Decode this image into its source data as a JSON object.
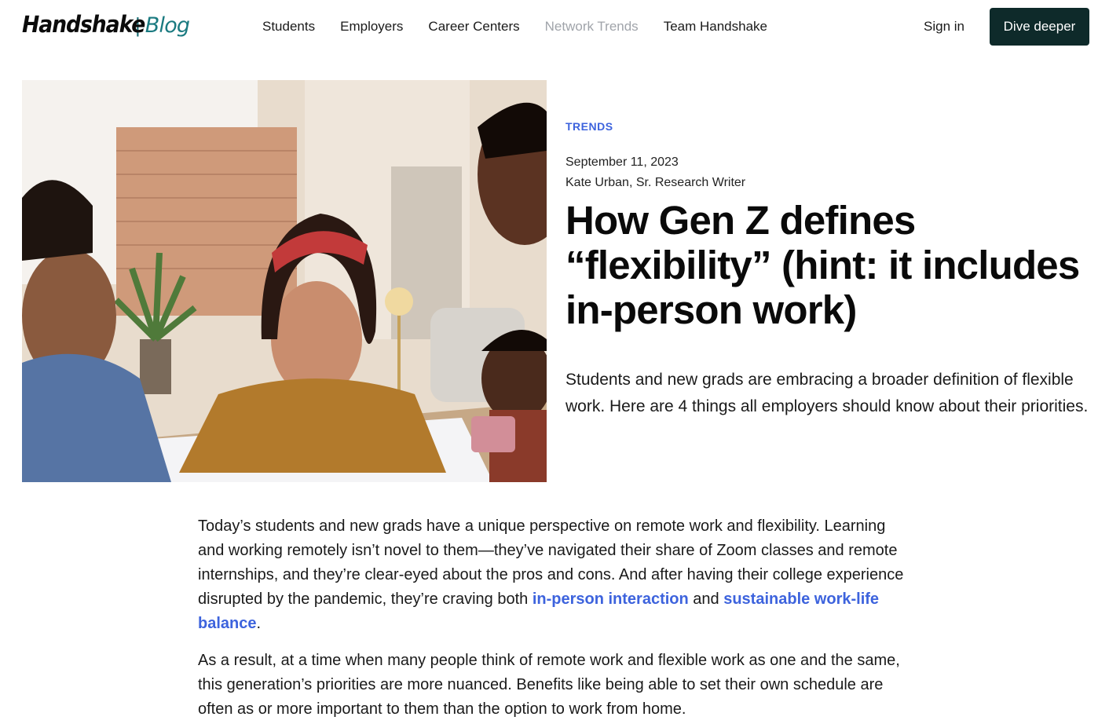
{
  "header": {
    "logo_main": "Handshake",
    "logo_sep": "|",
    "logo_blog": "Blog",
    "nav": [
      {
        "label": "Students"
      },
      {
        "label": "Employers"
      },
      {
        "label": "Career Centers"
      },
      {
        "label": "Network Trends"
      },
      {
        "label": "Team Handshake"
      }
    ],
    "sign_in": "Sign in",
    "cta": "Dive deeper"
  },
  "article": {
    "category": "TRENDS",
    "date": "September 11, 2023",
    "author": "Kate Urban, Sr. Research Writer",
    "title": "How Gen Z defines “flexibility” (hint: it includes in-person work)",
    "summary": "Students and new grads are embracing a broader definition of flexible work. Here are 4 things all employers should know about their priorities.",
    "p1_text_a": "Today’s students and new grads have a unique perspective on remote work and flexibility. Learning and working remotely isn’t novel to them—they’ve navigated their share of Zoom classes and remote internships, and they’re clear-eyed about the pros and cons. And after having their college experience disrupted by the pandemic, they’re craving both ",
    "p1_link_1": "in-person interaction",
    "p1_text_b": " and ",
    "p1_link_2": "sustainable work-life balance",
    "p1_text_c": ".",
    "p2": "As a result, at a time when many people think of remote work and flexible work as one and the same, this generation’s priorities are more nuanced. Benefits like being able to set their own schedule are often as or more important to them than the option to work from home."
  },
  "colors": {
    "accent": "#3d63dd",
    "cta_bg": "#0e2a2a",
    "logo_blog": "#1a7a80",
    "nav_muted": "#a0a4aa"
  }
}
